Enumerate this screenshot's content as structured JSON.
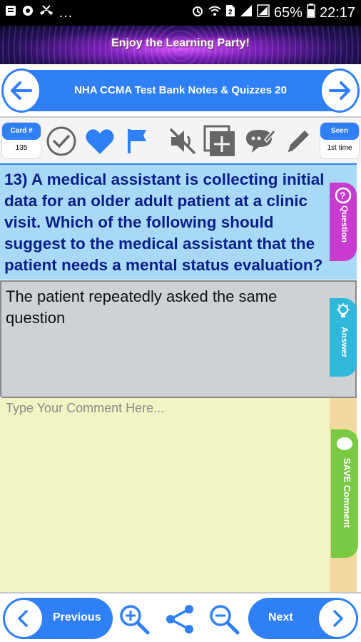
{
  "status_bar": {
    "battery_percent": "65%",
    "time": "22:17",
    "left_icons": [
      "notification-icon",
      "settings-icon",
      "missed-call-icon",
      "more-icon"
    ],
    "right_icons": [
      "alarm-icon",
      "wifi-icon",
      "sim-icon",
      "signal-icon",
      "battery-icon"
    ]
  },
  "banner": {
    "text": "Enjoy the Learning Party!"
  },
  "header": {
    "title": "NHA CCMA Test Bank Notes & Quizzes 20"
  },
  "toolbar": {
    "card_label": "Card #",
    "card_number": "135",
    "seen_label": "Seen",
    "seen_value": "1st time",
    "icons": [
      "check-circle-icon",
      "heart-icon",
      "flag-icon",
      "mute-icon",
      "add-card-icon",
      "chat-edit-icon",
      "pencil-icon"
    ]
  },
  "question": {
    "text": "13) A medical assistant is collecting initial data for an older adult patient at a clinic visit. Which of the following should suggest to the medical assistant that the patient needs a mental status evaluation?",
    "tab_label": "Question"
  },
  "answer": {
    "text": "The patient repeatedly asked the same question",
    "tab_label": "Answer"
  },
  "comment": {
    "placeholder": "Type Your Comment Here...",
    "tab_label": "SAVE Comment"
  },
  "bottom_nav": {
    "previous_label": "Previous",
    "next_label": "Next",
    "icons": [
      "zoom-in-icon",
      "share-icon",
      "zoom-out-icon"
    ]
  },
  "colors": {
    "primary_blue": "#2f7ff7",
    "question_bg": "#a8daf7",
    "question_text": "#0a1f8a",
    "answer_bg": "#cfd2d4",
    "comment_bg": "#f2f4c4",
    "question_tab": "#c93bd0",
    "answer_tab": "#2fb7dc",
    "comment_tab": "#7ac943"
  }
}
